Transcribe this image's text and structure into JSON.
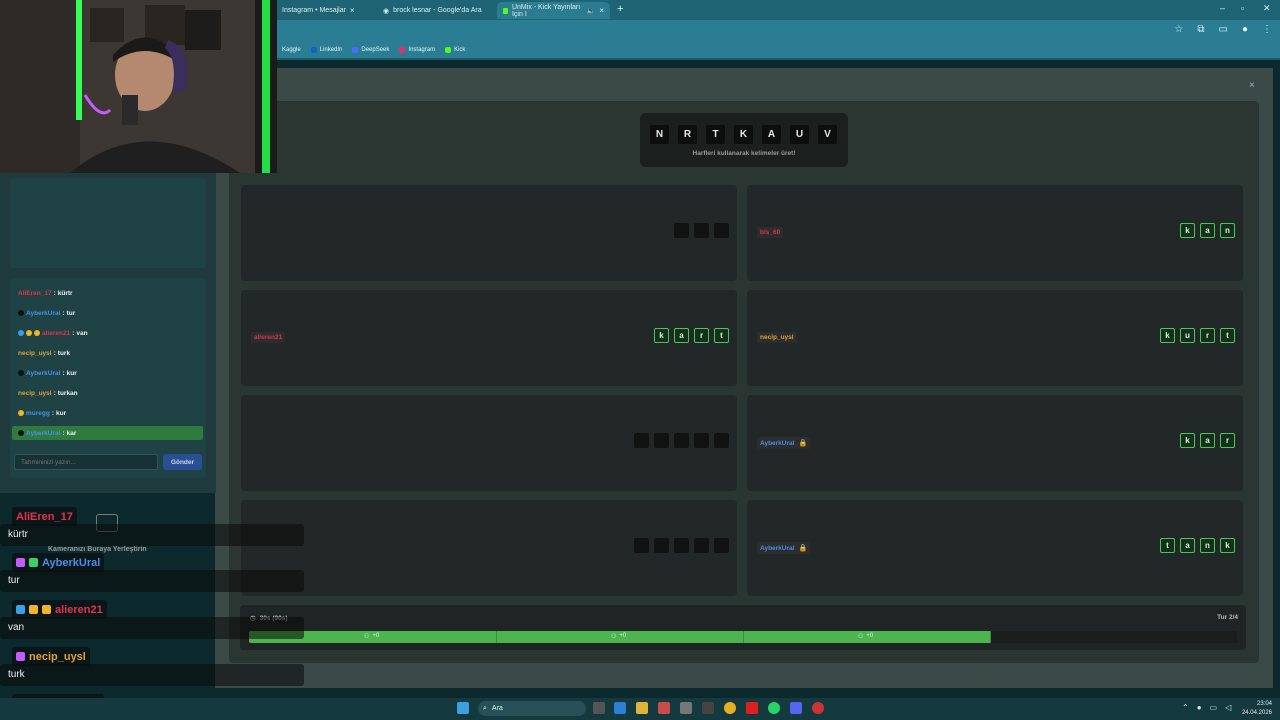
{
  "browser": {
    "tabs": [
      {
        "label": "Instagram • Mesajlar",
        "active": false
      },
      {
        "label": "brock lesnar - Google'da Ara",
        "active": false
      },
      {
        "label": "UnMix - Kick Yayınları İçin I",
        "active": true
      }
    ],
    "new_tab": "+",
    "window_controls": [
      "–",
      "▫",
      "✕"
    ],
    "bookmarks": [
      "Kaggle",
      "LinkedIn",
      "DeepSeek",
      "Instagram",
      "Kick"
    ]
  },
  "game": {
    "close": "×",
    "letters": [
      "N",
      "R",
      "T",
      "K",
      "A",
      "U",
      "V"
    ],
    "letters_hint": "Harfleri kullanarak kelimeler üret!",
    "cards": [
      {
        "player": "",
        "locked": false,
        "word": [
          "",
          "",
          ""
        ],
        "filled": false
      },
      {
        "player": "bls_60",
        "player_color": "#d8344f",
        "locked": false,
        "word": [
          "k",
          "a",
          "n"
        ],
        "filled": true
      },
      {
        "player": "alieren21",
        "player_color": "#d8344f",
        "locked": false,
        "word": [
          "k",
          "a",
          "r",
          "t"
        ],
        "filled": true
      },
      {
        "player": "necip_uysl",
        "player_color": "#e0a23a",
        "locked": false,
        "word": [
          "k",
          "u",
          "r",
          "t"
        ],
        "filled": true
      },
      {
        "player": "",
        "locked": false,
        "word": [
          "",
          "",
          "",
          "",
          ""
        ],
        "filled": false
      },
      {
        "player": "AyberkUral",
        "player_color": "#4a8ee8",
        "locked": true,
        "word": [
          "k",
          "a",
          "r"
        ],
        "filled": true
      },
      {
        "player": "",
        "locked": false,
        "word": [
          "",
          "",
          "",
          "",
          ""
        ],
        "filled": false
      },
      {
        "player": "AyberkUral",
        "player_color": "#4a8ee8",
        "locked": true,
        "word": [
          "t",
          "a",
          "n",
          "k"
        ],
        "filled": true
      }
    ],
    "timer": "30s (90s)",
    "turn": "Tur 2/4",
    "progress": 0.75,
    "progress_segments": [
      "+0",
      "+0",
      "+0"
    ]
  },
  "chat_panel": {
    "messages": [
      {
        "user": "AliEren_17",
        "color": "#e0344f",
        "text": "kürtr",
        "badges": []
      },
      {
        "user": "AyberkUral",
        "color": "#4a8ee8",
        "text": "tur",
        "badges": [
          "#111"
        ]
      },
      {
        "user": "alieren21",
        "color": "#e0344f",
        "text": "van",
        "badges": [
          "#3aa0e8",
          "#f0b429",
          "#f0b429"
        ]
      },
      {
        "user": "necip_uysl",
        "color": "#e0a23a",
        "text": "turk",
        "badges": []
      },
      {
        "user": "AyberkUral",
        "color": "#4a8ee8",
        "text": "kur",
        "badges": [
          "#111"
        ]
      },
      {
        "user": "necip_uysl",
        "color": "#e0a23a",
        "text": "turkan",
        "badges": []
      },
      {
        "user": "muregg",
        "color": "#4a8ee8",
        "text": "kur",
        "badges": [
          "#f0b429"
        ]
      },
      {
        "user": "AyberkUral",
        "color": "#4a8ee8",
        "text": "kar",
        "badges": [
          "#111"
        ],
        "highlight": true
      }
    ],
    "input_placeholder": "Tahmininizi yazın...",
    "send_label": "Gönder"
  },
  "stream_overlay": {
    "cam_hint": "Kameranızı Buraya Yerleştirin",
    "messages": [
      {
        "user": "AliEren_17",
        "color": "#e0344f",
        "text": "kürtr"
      },
      {
        "user": "AyberkUral",
        "color": "#4a8ee8",
        "text": "tur"
      },
      {
        "user": "alieren21",
        "color": "#e0344f",
        "text": "van"
      },
      {
        "user": "necip_uysl",
        "color": "#e0a23a",
        "text": "turk"
      },
      {
        "user": "AyberkUral",
        "color": "#4a8ee8",
        "text": "kur"
      }
    ]
  },
  "taskbar": {
    "search_placeholder": "Ara",
    "time": "23:04",
    "date": "24.04.2026"
  }
}
